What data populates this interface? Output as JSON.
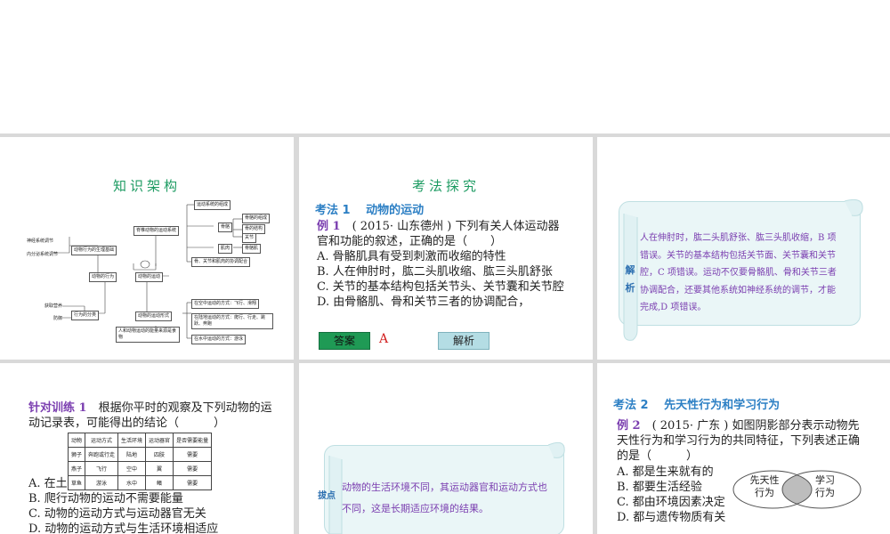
{
  "slide1": {
    "title": "知识架构",
    "mindmap": {
      "root": "脊椎动物的运动系统",
      "left_labels": [
        "神经系统调节",
        "内分泌系统调节",
        "获取营养",
        "防御"
      ],
      "nodes": {
        "physio": "动物行为的生理基础",
        "behavior": "动物的行为",
        "movement": "动物的运动",
        "classify": "行为的分类",
        "motion_types": "动物的运动形式",
        "composition": "运动系统的组成",
        "bone": "骨骼",
        "bone_comp": "骨骼的组成",
        "bone_struct": "骨的结构",
        "joint": "关节",
        "muscle": "肌肉",
        "skeletal_muscle": "骨骼肌",
        "coordination": "骨、关节和肌肉的协调配合",
        "env_water_air": "在空中运动的方式：飞行、滑翔",
        "env_land": "在陆地运动的方式：爬行、行走、跳跃、奔跑",
        "env_water": "在水中运动的方式：游泳",
        "human": "人和动物运动的能量来源是食物"
      }
    }
  },
  "slide2": {
    "title": "考法探究",
    "section": "考法 1　 动物的运动",
    "example_label": "例 1",
    "question": "　( 2015· 山东德州 ) 下列有关人体运动器官和功能的叙述，正确的是（　　）",
    "options": [
      "A. 骨骼肌具有受到刺激而收缩的特性",
      "B. 人在伸肘时，肱二头肌收缩、肱三头肌舒张",
      "C. 关节的基本结构包括关节头、关节囊和关节腔",
      "D. 由骨骼肌、骨和关节三者的协调配合，"
    ],
    "answer_button": "答案",
    "answer_value": "A",
    "explain_button": "解析"
  },
  "slide3": {
    "tag": "解析",
    "text": "人在伸肘时，肱二头肌舒张、肱三头肌收缩，B 项错误。关节的基本结构包括关节面、关节囊和关节腔，C 项错误。运动不仅要骨骼肌、骨和关节三者协调配合，还要其他系统如神经系统的调节，才能完成,D 项错误。"
  },
  "slide4": {
    "label": "针对训练 1",
    "question": "　根据你平时的观察及下列动物的运动记录表，可能得出的结论（　　　）",
    "table": {
      "headers": [
        "动物",
        "运动方式",
        "生活环境",
        "运动器官",
        "是否需要能量"
      ],
      "rows": [
        [
          "狮子",
          "奔跑或行走",
          "陆地",
          "四肢",
          "需要"
        ],
        [
          "燕子",
          "飞行",
          "空中",
          "翼",
          "需要"
        ],
        [
          "草鱼",
          "游泳",
          "水中",
          "鳍",
          "需要"
        ]
      ]
    },
    "options": [
      "A. 在土",
      "B. 爬行动物的运动不需要能量",
      "C. 动物的运动方式与运动器官无关",
      "D. 动物的运动方式与生活环境相适应"
    ]
  },
  "slide5": {
    "tag": "拔点",
    "text": "动物的生活环境不同，其运动器官和运动方式也不同，这是长期适应环境的结果。"
  },
  "slide6": {
    "section": "考法 2　 先天性行为和学习行为",
    "example_label": "例 2",
    "question": "　( 2015· 广东 ) 如图阴影部分表示动物先天性行为和学习行为的共同特征，下列表述正确的是（　　　）",
    "options": [
      "A. 都是生来就有的",
      "B. 都要生活经验",
      "C. 都由环境因素决定",
      "D. 都与遗传物质有关"
    ],
    "venn": {
      "left": "先天性行为",
      "right": "学习行为"
    }
  }
}
